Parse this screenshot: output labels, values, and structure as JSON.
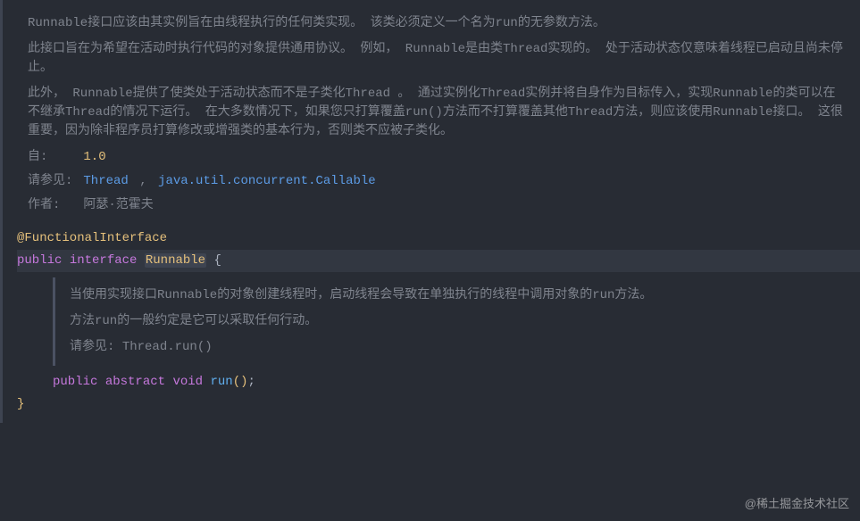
{
  "doc": {
    "p1": "Runnable接口应该由其实例旨在由线程执行的任何类实现。 该类必须定义一个名为run的无参数方法。",
    "p2": "此接口旨在为希望在活动时执行代码的对象提供通用协议。 例如， Runnable是由类Thread实现的。 处于活动状态仅意味着线程已启动且尚未停止。",
    "p3": "此外， Runnable提供了使类处于活动状态而不是子类化Thread 。 通过实例化Thread实例并将自身作为目标传入，实现Runnable的类可以在不继承Thread的情况下运行。 在大多数情况下，如果您只打算覆盖run()方法而不打算覆盖其他Thread方法，则应该使用Runnable接口。 这很重要，因为除非程序员打算修改或增强类的基本行为，否则类不应被子类化。",
    "since_label": "自:",
    "since_value": "1.0",
    "see_label": "请参见:",
    "see_link1": "Thread",
    "see_sep": ",",
    "see_link2": "java.util.concurrent.Callable",
    "author_label": "作者:",
    "author_value": "阿瑟·范霍夫"
  },
  "code": {
    "annotation": "@FunctionalInterface",
    "kw_public": "public",
    "kw_interface": "interface",
    "type_runnable": "Runnable",
    "brace_open": "{",
    "kw_abstract": "abstract",
    "kw_void": "void",
    "method_run": "run",
    "paren": "()",
    "semi": ";",
    "brace_close": "}"
  },
  "inner_doc": {
    "p1": "当使用实现接口Runnable的对象创建线程时，启动线程会导致在单独执行的线程中调用对象的run方法。",
    "p2": "方法run的一般约定是它可以采取任何行动。",
    "see_label": "请参见:",
    "see_link": "Thread.run()"
  },
  "watermark": "@稀土掘金技术社区"
}
